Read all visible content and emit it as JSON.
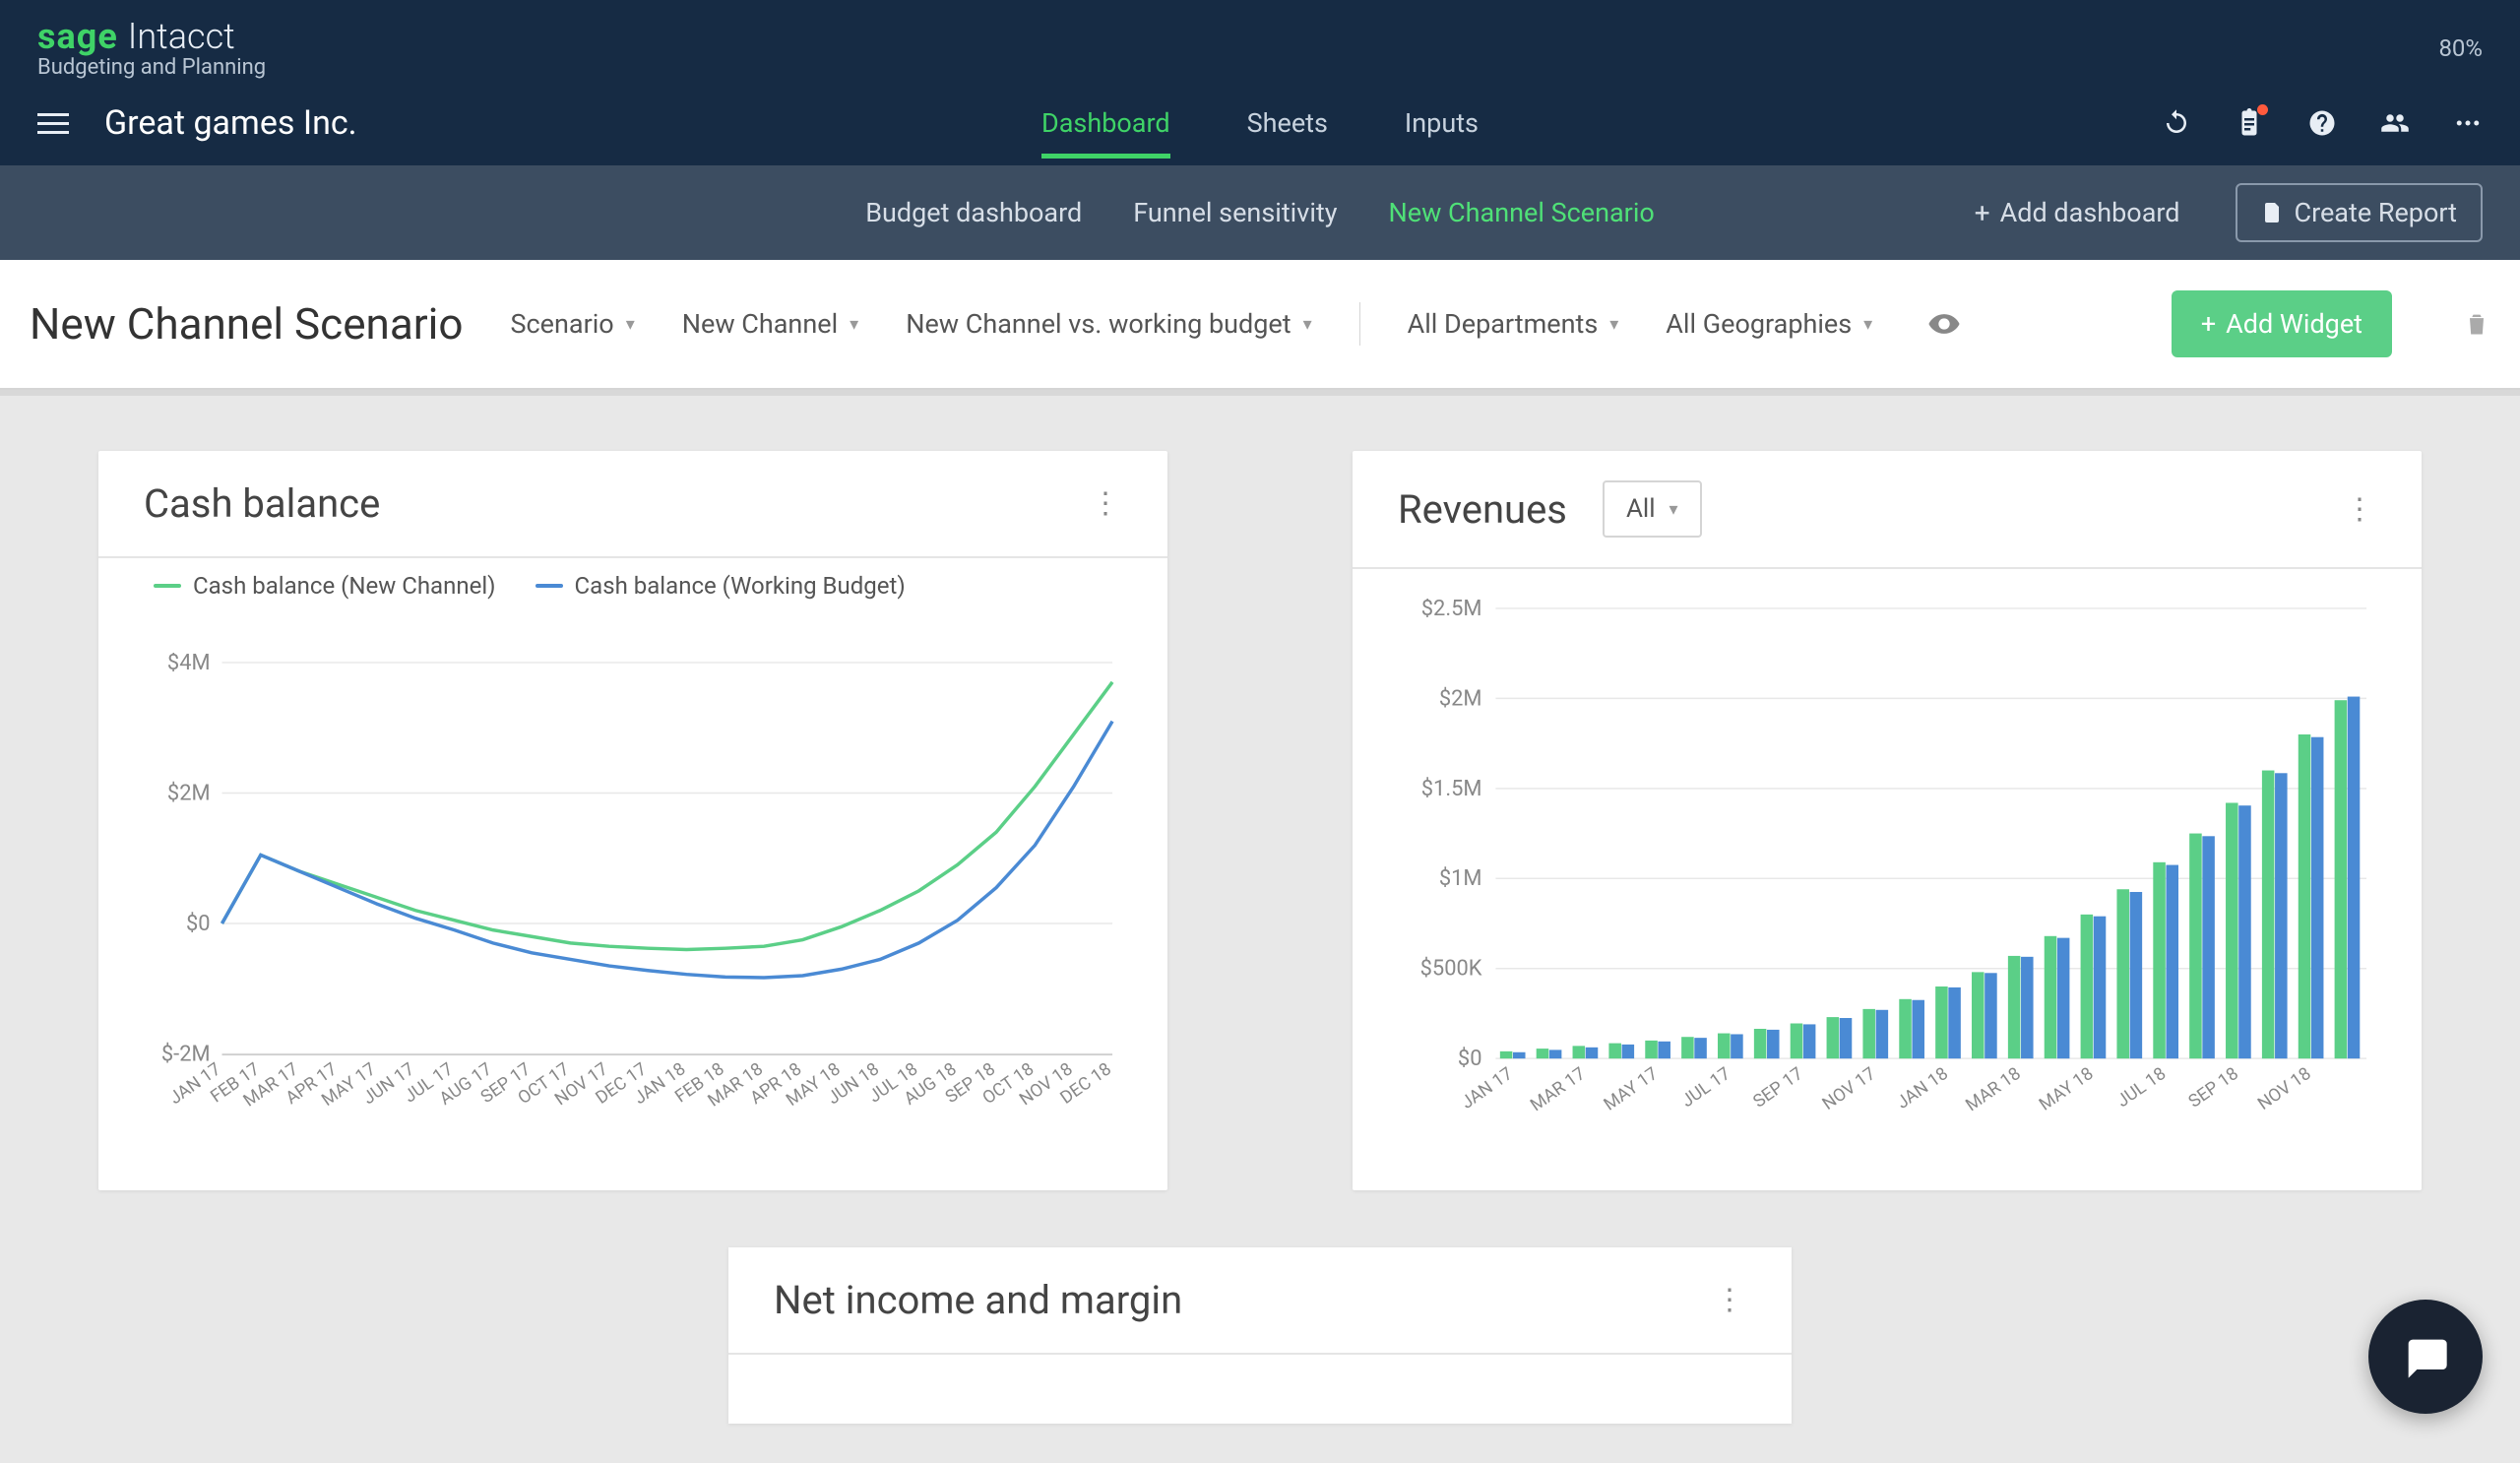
{
  "brand": {
    "sage": "sage",
    "intacct": "Intacct",
    "sub": "Budgeting and Planning"
  },
  "zoom": "80%",
  "org": "Great games Inc.",
  "nav": {
    "tabs": [
      "Dashboard",
      "Sheets",
      "Inputs"
    ],
    "active": 0
  },
  "sub": {
    "tabs": [
      "Budget dashboard",
      "Funnel sensitivity",
      "New Channel Scenario"
    ],
    "active": 2,
    "add_dashboard": "Add dashboard",
    "create_report": "Create Report"
  },
  "filter": {
    "title": "New Channel Scenario",
    "drops": [
      "Scenario",
      "New Channel",
      "New Channel vs. working budget",
      "All Departments",
      "All Geographies"
    ],
    "add_widget": "Add Widget"
  },
  "widgets": {
    "cash": {
      "title": "Cash balance",
      "legend": [
        "Cash balance (New Channel)",
        "Cash balance (Working Budget)"
      ]
    },
    "rev": {
      "title": "Revenues",
      "filter": "All"
    },
    "net": {
      "title": "Net income and margin"
    }
  },
  "colors": {
    "green": "#5bcf87",
    "blue": "#4a8ad4",
    "bg_dark": "#162b44",
    "bg_mid": "#3c4d61"
  },
  "chart_data": [
    {
      "id": "cash_balance",
      "type": "line",
      "xlabel": "",
      "ylabel": "",
      "y_ticks": [
        -2000000,
        0,
        2000000,
        4000000
      ],
      "y_tick_labels": [
        "$-2M",
        "$0",
        "$2M",
        "$4M"
      ],
      "categories": [
        "JAN 17",
        "FEB 17",
        "MAR 17",
        "APR 17",
        "MAY 17",
        "JUN 17",
        "JUL 17",
        "AUG 17",
        "SEP 17",
        "OCT 17",
        "NOV 17",
        "DEC 17",
        "JAN 18",
        "FEB 18",
        "MAR 18",
        "APR 18",
        "MAY 18",
        "JUN 18",
        "JUL 18",
        "AUG 18",
        "SEP 18",
        "OCT 18",
        "NOV 18",
        "DEC 18"
      ],
      "series": [
        {
          "name": "Cash balance (New Channel)",
          "color": "#5bcf87",
          "values": [
            0,
            1050000,
            800000,
            600000,
            400000,
            200000,
            50000,
            -100000,
            -200000,
            -300000,
            -350000,
            -380000,
            -400000,
            -380000,
            -350000,
            -250000,
            -50000,
            200000,
            500000,
            900000,
            1400000,
            2100000,
            2900000,
            3700000
          ]
        },
        {
          "name": "Cash balance (Working Budget)",
          "color": "#4a8ad4",
          "values": [
            0,
            1050000,
            800000,
            550000,
            300000,
            80000,
            -100000,
            -300000,
            -450000,
            -550000,
            -650000,
            -720000,
            -780000,
            -820000,
            -830000,
            -800000,
            -700000,
            -550000,
            -300000,
            50000,
            550000,
            1200000,
            2100000,
            3100000
          ]
        }
      ],
      "ylim": [
        -2000000,
        4000000
      ]
    },
    {
      "id": "revenues",
      "type": "bar",
      "xlabel": "",
      "ylabel": "",
      "y_ticks": [
        0,
        500000,
        1000000,
        1500000,
        2000000,
        2500000
      ],
      "y_tick_labels": [
        "$0",
        "$500K",
        "$1M",
        "$1.5M",
        "$2M",
        "$2.5M"
      ],
      "categories": [
        "JAN 17",
        "FEB 17",
        "MAR 17",
        "APR 17",
        "MAY 17",
        "JUN 17",
        "JUL 17",
        "AUG 17",
        "SEP 17",
        "OCT 17",
        "NOV 17",
        "DEC 17",
        "JAN 18",
        "FEB 18",
        "MAR 18",
        "APR 18",
        "MAY 18",
        "JUN 18",
        "JUL 18",
        "AUG 18",
        "SEP 18",
        "OCT 18",
        "NOV 18",
        "DEC 18"
      ],
      "x_tick_labels": [
        "JAN 17",
        "",
        "MAR 17",
        "",
        "MAY 17",
        "",
        "JUL 17",
        "",
        "SEP 17",
        "",
        "NOV 17",
        "",
        "JAN 18",
        "",
        "MAR 18",
        "",
        "MAY 18",
        "",
        "JUL 18",
        "",
        "SEP 18",
        "",
        "NOV 18",
        ""
      ],
      "series": [
        {
          "name": "New Channel",
          "color": "#5bcf87",
          "values": [
            40000,
            55000,
            70000,
            85000,
            100000,
            120000,
            140000,
            165000,
            195000,
            230000,
            275000,
            330000,
            400000,
            480000,
            570000,
            680000,
            800000,
            940000,
            1090000,
            1250000,
            1420000,
            1600000,
            1800000,
            1990000
          ]
        },
        {
          "name": "Working Budget",
          "color": "#4a8ad4",
          "values": [
            35000,
            48000,
            62000,
            78000,
            95000,
            115000,
            135000,
            160000,
            190000,
            225000,
            270000,
            325000,
            395000,
            475000,
            565000,
            670000,
            790000,
            925000,
            1075000,
            1235000,
            1405000,
            1585000,
            1785000,
            2010000
          ]
        }
      ],
      "ylim": [
        0,
        2500000
      ]
    }
  ]
}
